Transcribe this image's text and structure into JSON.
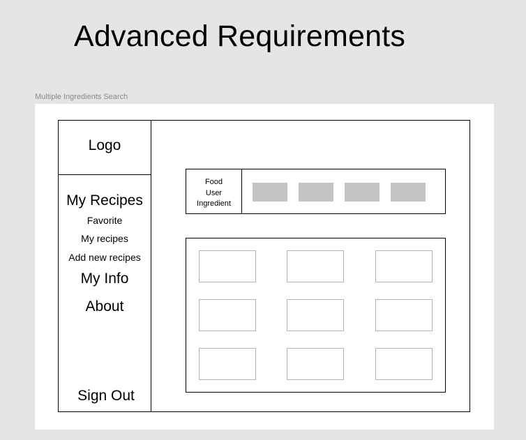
{
  "page": {
    "title": "Advanced Requirements",
    "frame_label": "Multiple Ingredients Search"
  },
  "sidebar": {
    "logo": "Logo",
    "items": [
      {
        "label": "My Recipes",
        "level": "section"
      },
      {
        "label": "Favorite",
        "level": "sub"
      },
      {
        "label": "My recipes",
        "level": "sub"
      },
      {
        "label": "Add new recipes",
        "level": "sub"
      },
      {
        "label": "My Info",
        "level": "section"
      },
      {
        "label": "About",
        "level": "section"
      }
    ],
    "sign_out": "Sign Out"
  },
  "search": {
    "filters": [
      "Food",
      "User",
      "Ingredient"
    ],
    "chip_count": 4
  },
  "results": {
    "card_count": 9
  },
  "colors": {
    "canvas": "#e5e5e5",
    "frame": "#ffffff",
    "chip": "#c4c4c4",
    "card_border": "#b3b3b3",
    "label": "#888888"
  }
}
